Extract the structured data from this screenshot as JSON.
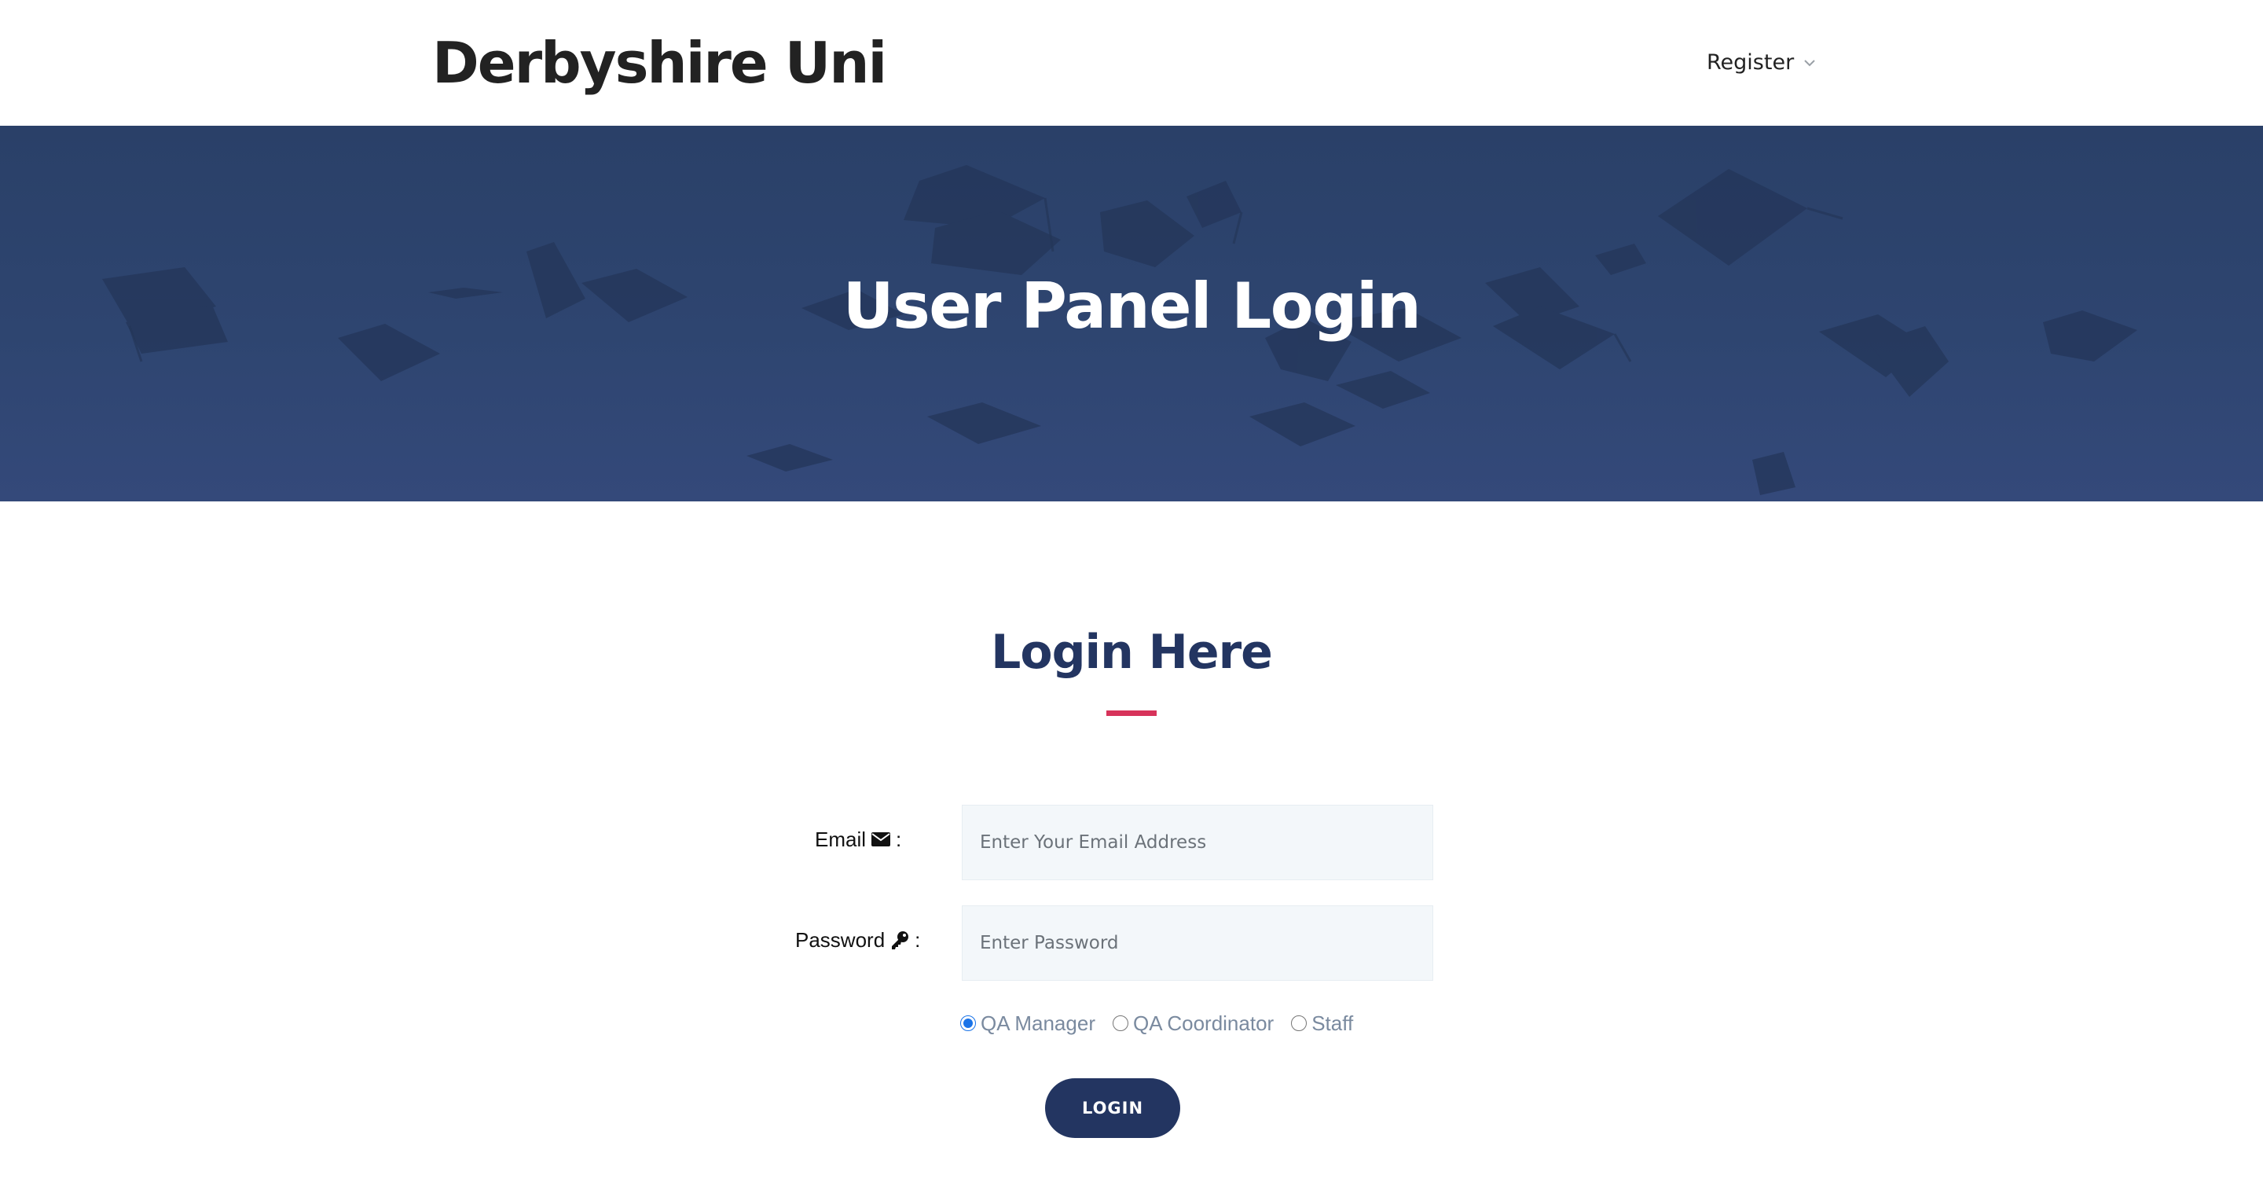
{
  "header": {
    "brand": "Derbyshire Uni",
    "nav": {
      "register_label": "Register"
    }
  },
  "hero": {
    "title": "User Panel Login",
    "background_color": "#2e4570"
  },
  "login_section": {
    "title": "Login Here",
    "underline_color": "#d7335a",
    "email": {
      "label": "Email",
      "icon": "envelope-icon",
      "separator": ":",
      "placeholder": "Enter Your Email Address",
      "value": ""
    },
    "password": {
      "label": "Password",
      "icon": "key-icon",
      "separator": ":",
      "placeholder": "Enter Password",
      "value": ""
    },
    "roles": [
      {
        "label": "QA Manager",
        "value": "QA Manager",
        "checked": true
      },
      {
        "label": "QA Coordinator",
        "value": "QA Coordinator",
        "checked": false
      },
      {
        "label": "Staff",
        "value": "Staff",
        "checked": false
      }
    ],
    "login_button": "LOGIN"
  },
  "colors": {
    "primary": "#233561",
    "accent": "#d7335a",
    "input_bg": "#f3f7fa"
  }
}
